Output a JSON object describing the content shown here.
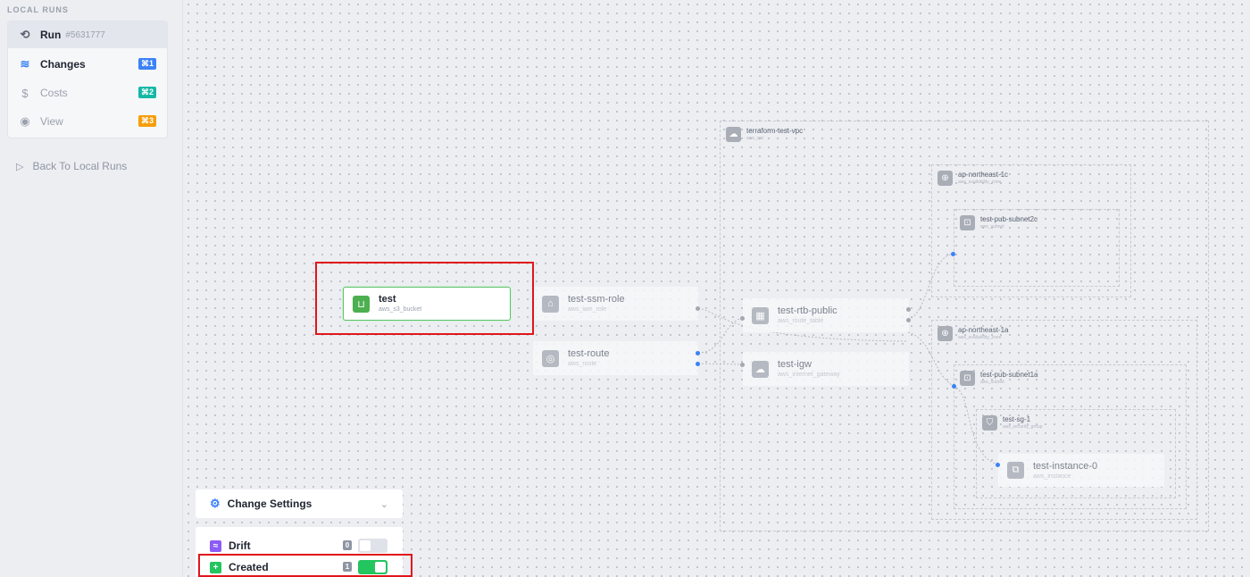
{
  "sidebar": {
    "section_label": "LOCAL RUNS",
    "run": {
      "label": "Run",
      "id": "#5631777",
      "icon": "history-icon"
    },
    "items": [
      {
        "label": "Changes",
        "shortcut": "⌘1",
        "icon": "layers-icon",
        "shortcut_color": "#3b82f6"
      },
      {
        "label": "Costs",
        "shortcut": "⌘2",
        "icon": "dollar-icon",
        "shortcut_color": "#14b8a6"
      },
      {
        "label": "View",
        "shortcut": "⌘3",
        "icon": "eye-icon",
        "shortcut_color": "#f59e0b"
      }
    ],
    "back_link": "Back To Local Runs"
  },
  "graph": {
    "groups": {
      "vpc": {
        "title": "terraform-test-vpc",
        "type": "aws_vpc"
      },
      "az1c": {
        "title": "ap-northeast-1c",
        "type": "aws_availability_zone"
      },
      "subnet2c": {
        "title": "test-pub-subnet2c",
        "type": "aws_subnet"
      },
      "az1a": {
        "title": "ap-northeast-1a",
        "type": "aws_availability_zone"
      },
      "subnet1a": {
        "title": "test-pub-subnet1a",
        "type": "aws_subnet"
      },
      "sg1": {
        "title": "test-sg-1",
        "type": "aws_security_group"
      }
    },
    "nodes": {
      "bucket": {
        "title": "test",
        "type": "aws_s3_bucket",
        "status": "created"
      },
      "ssm_role": {
        "title": "test-ssm-role",
        "type": "aws_iam_role"
      },
      "route": {
        "title": "test-route",
        "type": "aws_route"
      },
      "rtb": {
        "title": "test-rtb-public",
        "type": "aws_route_table"
      },
      "igw": {
        "title": "test-igw",
        "type": "aws_internet_gateway"
      },
      "instance": {
        "title": "test-instance-0",
        "type": "aws_instance"
      }
    }
  },
  "change_settings": {
    "label": "Change Settings",
    "icon": "gear-icon"
  },
  "filters": [
    {
      "label": "Drift",
      "count": "0",
      "enabled": false,
      "color": "#8b5cf6",
      "icon": "drift-icon"
    },
    {
      "label": "Created",
      "count": "1",
      "enabled": true,
      "color": "#22c55e",
      "icon": "plus-icon"
    }
  ],
  "colors": {
    "accent": "#3b82f6",
    "created": "#4caf50",
    "highlight": "#e0161b"
  }
}
